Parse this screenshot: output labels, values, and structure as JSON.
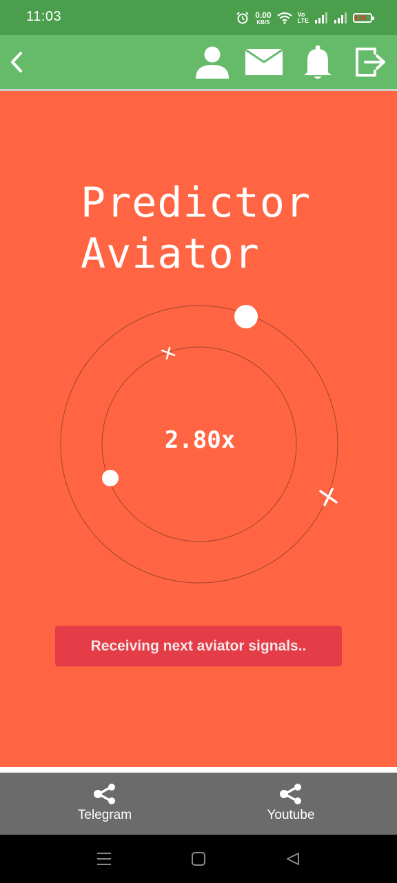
{
  "status_bar": {
    "time": "11:03",
    "net_speed_value": "0.00",
    "net_speed_unit": "KB/S",
    "volte_top": "Vo",
    "volte_bottom": "LTE",
    "battery_level": "16",
    "icons": [
      "alarm-icon",
      "wifi-icon",
      "signal-icon",
      "battery-icon"
    ]
  },
  "header": {
    "icons": [
      "back-icon",
      "profile-icon",
      "mail-icon",
      "bell-icon",
      "logout-icon"
    ]
  },
  "main": {
    "title_line1": "Predictor",
    "title_line2": "Aviator",
    "multiplier": "2.80x",
    "signal_label": "Receiving next aviator signals.."
  },
  "footer": {
    "links": [
      {
        "label": "Telegram",
        "icon": "share-icon"
      },
      {
        "label": "Youtube",
        "icon": "share-icon"
      }
    ]
  },
  "nav": {
    "icons": [
      "recents-icon",
      "home-icon",
      "back-triangle-icon"
    ]
  },
  "colors": {
    "status_bar": "#4a9e4c",
    "header": "#66bb6a",
    "main_bg": "#ff6542",
    "button": "#e43d48",
    "footer": "#6b6b6b",
    "nav": "#000000"
  }
}
